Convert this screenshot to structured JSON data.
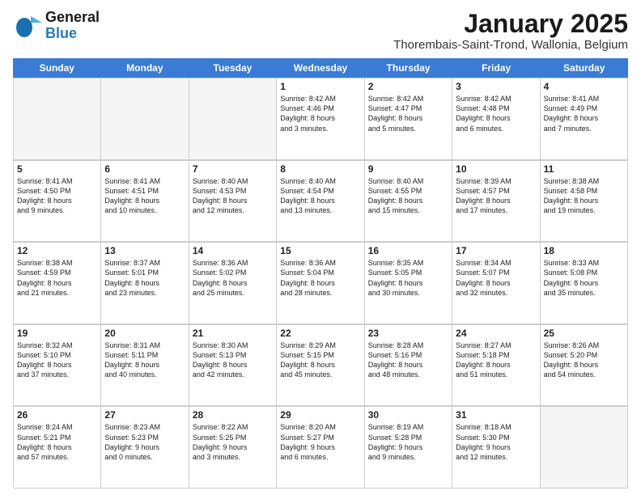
{
  "logo": {
    "line1": "General",
    "line2": "Blue"
  },
  "title": "January 2025",
  "subtitle": "Thorembais-Saint-Trond, Wallonia, Belgium",
  "days": [
    "Sunday",
    "Monday",
    "Tuesday",
    "Wednesday",
    "Thursday",
    "Friday",
    "Saturday"
  ],
  "rows": [
    [
      {
        "day": "",
        "text": ""
      },
      {
        "day": "",
        "text": ""
      },
      {
        "day": "",
        "text": ""
      },
      {
        "day": "1",
        "text": "Sunrise: 8:42 AM\nSunset: 4:46 PM\nDaylight: 8 hours\nand 3 minutes."
      },
      {
        "day": "2",
        "text": "Sunrise: 8:42 AM\nSunset: 4:47 PM\nDaylight: 8 hours\nand 5 minutes."
      },
      {
        "day": "3",
        "text": "Sunrise: 8:42 AM\nSunset: 4:48 PM\nDaylight: 8 hours\nand 6 minutes."
      },
      {
        "day": "4",
        "text": "Sunrise: 8:41 AM\nSunset: 4:49 PM\nDaylight: 8 hours\nand 7 minutes."
      }
    ],
    [
      {
        "day": "5",
        "text": "Sunrise: 8:41 AM\nSunset: 4:50 PM\nDaylight: 8 hours\nand 9 minutes."
      },
      {
        "day": "6",
        "text": "Sunrise: 8:41 AM\nSunset: 4:51 PM\nDaylight: 8 hours\nand 10 minutes."
      },
      {
        "day": "7",
        "text": "Sunrise: 8:40 AM\nSunset: 4:53 PM\nDaylight: 8 hours\nand 12 minutes."
      },
      {
        "day": "8",
        "text": "Sunrise: 8:40 AM\nSunset: 4:54 PM\nDaylight: 8 hours\nand 13 minutes."
      },
      {
        "day": "9",
        "text": "Sunrise: 8:40 AM\nSunset: 4:55 PM\nDaylight: 8 hours\nand 15 minutes."
      },
      {
        "day": "10",
        "text": "Sunrise: 8:39 AM\nSunset: 4:57 PM\nDaylight: 8 hours\nand 17 minutes."
      },
      {
        "day": "11",
        "text": "Sunrise: 8:38 AM\nSunset: 4:58 PM\nDaylight: 8 hours\nand 19 minutes."
      }
    ],
    [
      {
        "day": "12",
        "text": "Sunrise: 8:38 AM\nSunset: 4:59 PM\nDaylight: 8 hours\nand 21 minutes."
      },
      {
        "day": "13",
        "text": "Sunrise: 8:37 AM\nSunset: 5:01 PM\nDaylight: 8 hours\nand 23 minutes."
      },
      {
        "day": "14",
        "text": "Sunrise: 8:36 AM\nSunset: 5:02 PM\nDaylight: 8 hours\nand 25 minutes."
      },
      {
        "day": "15",
        "text": "Sunrise: 8:36 AM\nSunset: 5:04 PM\nDaylight: 8 hours\nand 28 minutes."
      },
      {
        "day": "16",
        "text": "Sunrise: 8:35 AM\nSunset: 5:05 PM\nDaylight: 8 hours\nand 30 minutes."
      },
      {
        "day": "17",
        "text": "Sunrise: 8:34 AM\nSunset: 5:07 PM\nDaylight: 8 hours\nand 32 minutes."
      },
      {
        "day": "18",
        "text": "Sunrise: 8:33 AM\nSunset: 5:08 PM\nDaylight: 8 hours\nand 35 minutes."
      }
    ],
    [
      {
        "day": "19",
        "text": "Sunrise: 8:32 AM\nSunset: 5:10 PM\nDaylight: 8 hours\nand 37 minutes."
      },
      {
        "day": "20",
        "text": "Sunrise: 8:31 AM\nSunset: 5:11 PM\nDaylight: 8 hours\nand 40 minutes."
      },
      {
        "day": "21",
        "text": "Sunrise: 8:30 AM\nSunset: 5:13 PM\nDaylight: 8 hours\nand 42 minutes."
      },
      {
        "day": "22",
        "text": "Sunrise: 8:29 AM\nSunset: 5:15 PM\nDaylight: 8 hours\nand 45 minutes."
      },
      {
        "day": "23",
        "text": "Sunrise: 8:28 AM\nSunset: 5:16 PM\nDaylight: 8 hours\nand 48 minutes."
      },
      {
        "day": "24",
        "text": "Sunrise: 8:27 AM\nSunset: 5:18 PM\nDaylight: 8 hours\nand 51 minutes."
      },
      {
        "day": "25",
        "text": "Sunrise: 8:26 AM\nSunset: 5:20 PM\nDaylight: 8 hours\nand 54 minutes."
      }
    ],
    [
      {
        "day": "26",
        "text": "Sunrise: 8:24 AM\nSunset: 5:21 PM\nDaylight: 8 hours\nand 57 minutes."
      },
      {
        "day": "27",
        "text": "Sunrise: 8:23 AM\nSunset: 5:23 PM\nDaylight: 9 hours\nand 0 minutes."
      },
      {
        "day": "28",
        "text": "Sunrise: 8:22 AM\nSunset: 5:25 PM\nDaylight: 9 hours\nand 3 minutes."
      },
      {
        "day": "29",
        "text": "Sunrise: 8:20 AM\nSunset: 5:27 PM\nDaylight: 9 hours\nand 6 minutes."
      },
      {
        "day": "30",
        "text": "Sunrise: 8:19 AM\nSunset: 5:28 PM\nDaylight: 9 hours\nand 9 minutes."
      },
      {
        "day": "31",
        "text": "Sunrise: 8:18 AM\nSunset: 5:30 PM\nDaylight: 9 hours\nand 12 minutes."
      },
      {
        "day": "",
        "text": ""
      }
    ]
  ]
}
